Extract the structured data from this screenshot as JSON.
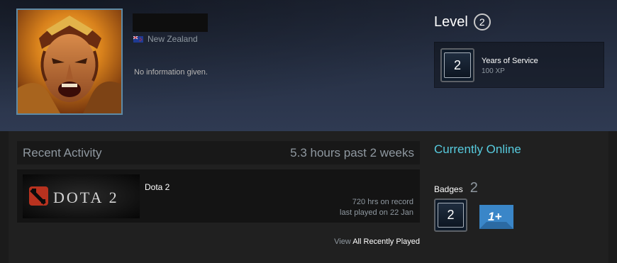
{
  "profile": {
    "location": "New Zealand",
    "summary": "No information given."
  },
  "level": {
    "label": "Level",
    "value": "2"
  },
  "favorite_badge": {
    "icon_value": "2",
    "title": "Years of Service",
    "xp": "100 XP"
  },
  "recent_activity": {
    "title": "Recent Activity",
    "hours_summary": "5.3 hours past 2 weeks",
    "games": [
      {
        "name": "Dota 2",
        "capsule_text": "DOTA 2",
        "hours_on_record": "720 hrs on record",
        "last_played": "last played on 22 Jan"
      }
    ],
    "view_all_prefix": "View",
    "view_all_link": "All Recently Played"
  },
  "status": {
    "text": "Currently Online"
  },
  "badges": {
    "label": "Badges",
    "count": "2",
    "items": [
      {
        "value": "2",
        "icon": "years-of-service-badge-icon"
      },
      {
        "value": "1+",
        "icon": "one-plus-badge-icon"
      }
    ]
  },
  "colors": {
    "online": "#57cbde",
    "accent_border": "#5e8aa6",
    "header_top": "#1e2535",
    "header_bottom": "#2f3a52",
    "content_bg": "#1b1b1b"
  }
}
